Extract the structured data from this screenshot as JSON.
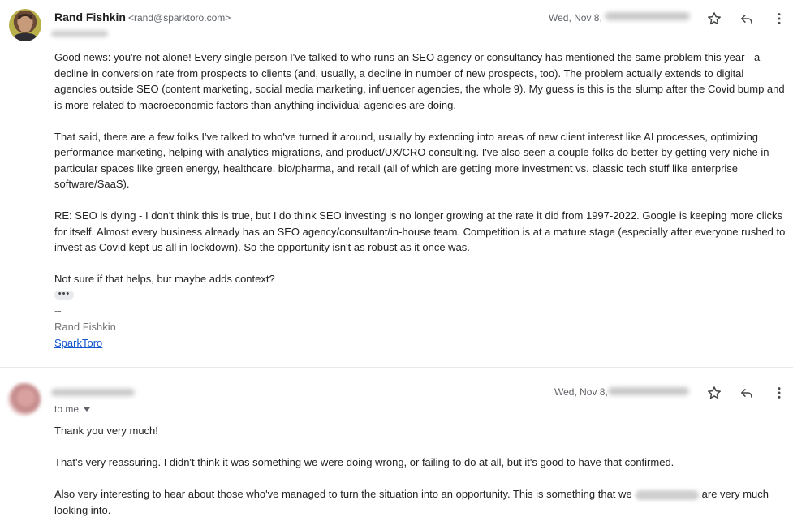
{
  "message1": {
    "sender_name": "Rand Fishkin",
    "sender_email": "<rand@sparktoro.com>",
    "date": "Wed, Nov 8,",
    "paragraphs": [
      "Good news: you're not alone! Every single person I've talked to who runs an SEO agency or consultancy has mentioned the same problem this year - a decline in conversion rate from prospects to clients (and, usually, a decline in number of new prospects, too). The problem actually extends to digital agencies outside SEO (content marketing, social media marketing, influencer agencies, the whole 9). My guess is this is the slump after the Covid bump and is more related to macroeconomic factors than anything individual agencies are doing.",
      "That said, there are a few folks I've talked to who've turned it around, usually by extending into areas of new client interest like AI processes, optimizing performance marketing, helping with analytics migrations, and product/UX/CRO consulting. I've also seen a couple folks do better by getting very niche in particular spaces like green energy, healthcare, bio/pharma, and retail (all of which are getting more investment vs. classic tech stuff like enterprise software/SaaS).",
      "RE: SEO is dying - I don't think this is true, but I do think SEO investing is no longer growing at the rate it did from 1997-2022. Google is keeping more clicks for itself. Almost every business already has an SEO agency/consultant/in-house team. Competition is at a mature stage (especially after everyone rushed to invest as Covid kept us all in lockdown). So the opportunity isn't as robust as it once was.",
      "Not sure if that helps, but maybe adds context?"
    ],
    "ellipsis": "•••",
    "signature": {
      "dashes": "--",
      "name": "Rand Fishkin",
      "company_link": "SparkToro"
    }
  },
  "message2": {
    "date": "Wed, Nov 8,",
    "recipient": "to me",
    "paragraphs": [
      "Thank you very much!",
      "That's very reassuring. I didn't think it was something we were doing wrong, or failing to do at all, but it's good to have that confirmed."
    ],
    "para3_before": "Also very interesting to hear about those who've managed to turn the situation into an opportunity. This is something that we",
    "para3_after": "are very much looking into."
  },
  "icons": {
    "star": "star-icon",
    "reply": "reply-icon",
    "more": "more-vert-icon"
  }
}
